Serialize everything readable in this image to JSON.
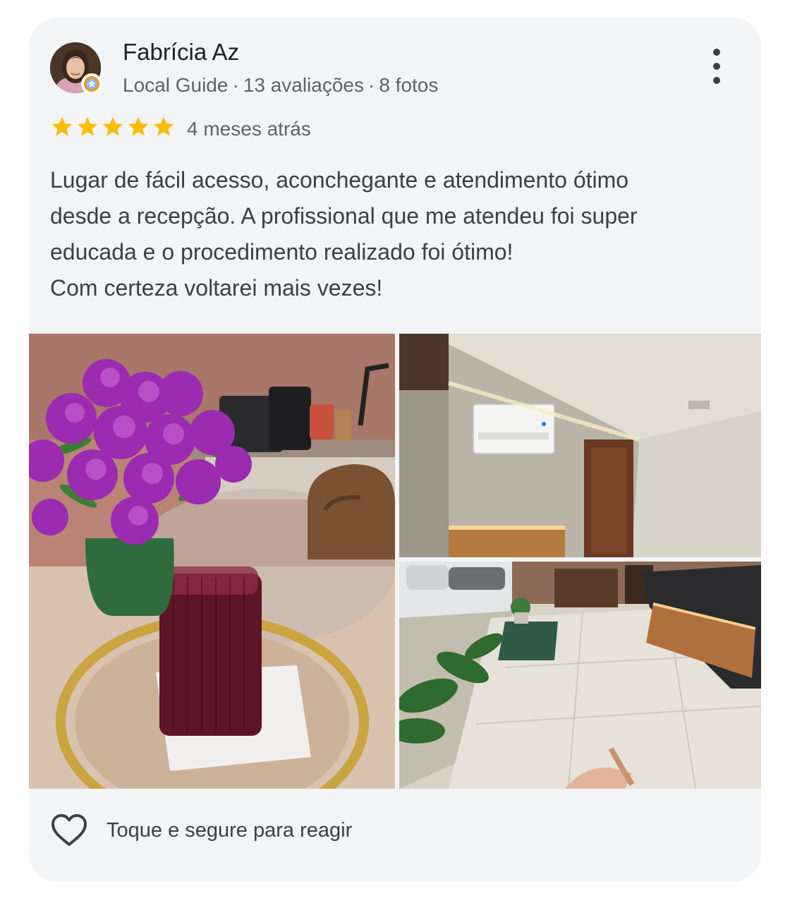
{
  "review": {
    "author_name": "Fabrícia Az",
    "author_badge": "Local Guide",
    "review_count": "13 avaliações",
    "photo_count": "8 fotos",
    "meta_separator": "·",
    "rating": 5,
    "rating_max": 5,
    "time_ago": "4 meses atrás",
    "text_lines": [
      "Lugar de fácil acesso, aconchegante e atendimento ótimo",
      "desde a recepção. A profissional que me atendeu foi super",
      "educada e o procedimento realizado foi ótimo!",
      "Com certeza voltarei mais vezes!"
    ]
  },
  "reaction": {
    "label": "Toque e segure para reagir",
    "icon": "heart-outline-icon"
  },
  "colors": {
    "card_bg": "#f3f4f6",
    "star": "#fbbc04",
    "text_primary": "#202124",
    "text_secondary": "#5f6368"
  }
}
